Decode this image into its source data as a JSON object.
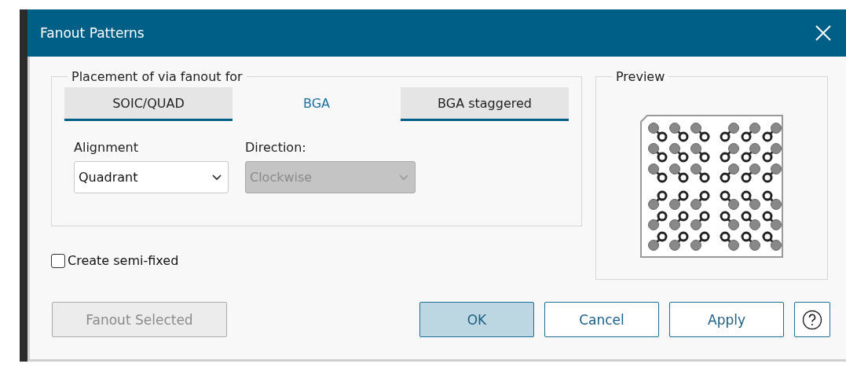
{
  "window": {
    "title": "Fanout Patterns"
  },
  "placement": {
    "legend": "Placement of via fanout for",
    "tabs": [
      {
        "label": "SOIC/QUAD",
        "selected": false
      },
      {
        "label": "BGA",
        "selected": true
      },
      {
        "label": "BGA staggered",
        "selected": false
      }
    ],
    "alignment": {
      "label": "Alignment",
      "value": "Quadrant",
      "disabled": false
    },
    "direction": {
      "label": "Direction:",
      "value": "Clockwise",
      "disabled": true
    }
  },
  "preview": {
    "legend": "Preview"
  },
  "semi_fixed": {
    "label": "Create semi-fixed",
    "checked": false
  },
  "buttons": [
    {
      "label": "Fanout Selected",
      "kind": "disabled"
    },
    {
      "label": "OK",
      "kind": "default"
    },
    {
      "label": "Cancel",
      "kind": "normal"
    },
    {
      "label": "Apply",
      "kind": "normal"
    }
  ]
}
